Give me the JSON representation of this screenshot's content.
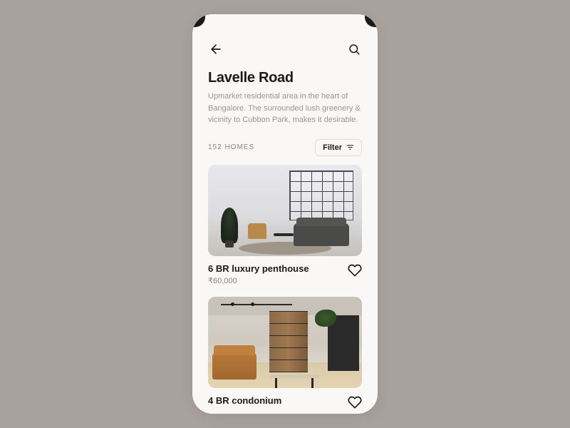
{
  "page": {
    "title": "Lavelle Road",
    "description": "Upmarket residential area in the heart of Bangalore. The surrounded lush greenery & vicinity to Cubbon Park, makes it desirable."
  },
  "meta": {
    "count_label": "152 HOMES",
    "filter_label": "Filter"
  },
  "listings": [
    {
      "title": "6 BR luxury penthouse",
      "price": "₹60,000"
    },
    {
      "title": "4 BR condonium",
      "price": ""
    }
  ]
}
